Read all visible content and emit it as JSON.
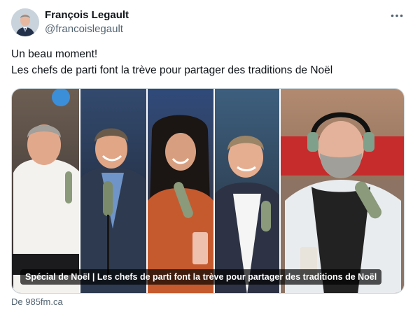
{
  "author": {
    "display_name": "François Legault",
    "handle": "@francoislegault",
    "avatar_icon": "profile-photo"
  },
  "tweet": {
    "line1": "Un beau moment!",
    "line2": "Les chefs de parti font la trève pour partager des traditions de Noël"
  },
  "card": {
    "caption": "Spécial de Noël | Les chefs de parti font la trève pour partager des traditions de Noël",
    "panel_count": 5
  },
  "source": {
    "text": "De 985fm.ca"
  },
  "menu": {
    "icon": "more-horizontal-icon"
  },
  "colors": {
    "text": "#0f1419",
    "secondary_text": "#536471",
    "border": "#cfd9de"
  }
}
